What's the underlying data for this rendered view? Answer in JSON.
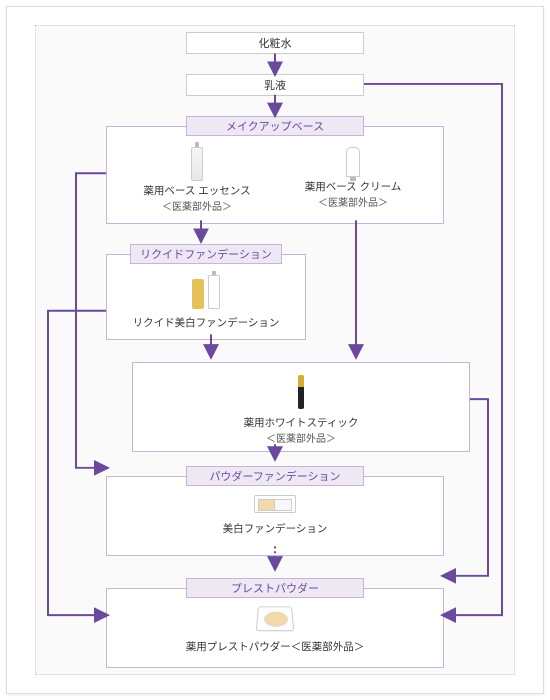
{
  "steps": {
    "lotion": "化粧水",
    "emulsion": "乳液"
  },
  "sections": {
    "makeup_base": "メイクアップベース",
    "liquid_foundation": "リクイドファンデーション",
    "powder_foundation": "パウダーファンデーション",
    "pressed_powder": "プレストパウダー"
  },
  "products": {
    "base_essence": {
      "name": "薬用ベース エッセンス",
      "note": "＜医薬部外品＞"
    },
    "base_cream": {
      "name": "薬用ベース クリーム",
      "note": "＜医薬部外品＞"
    },
    "liquid_whitening": {
      "name": "リクイド美白ファンデーション"
    },
    "white_stick": {
      "name": "薬用ホワイトスティック",
      "note": "＜医薬部外品＞"
    },
    "whitening_foundation": {
      "name": "美白ファンデーション"
    },
    "pressed_powder": {
      "name": "薬用プレストパウダー＜医薬部外品＞"
    }
  }
}
